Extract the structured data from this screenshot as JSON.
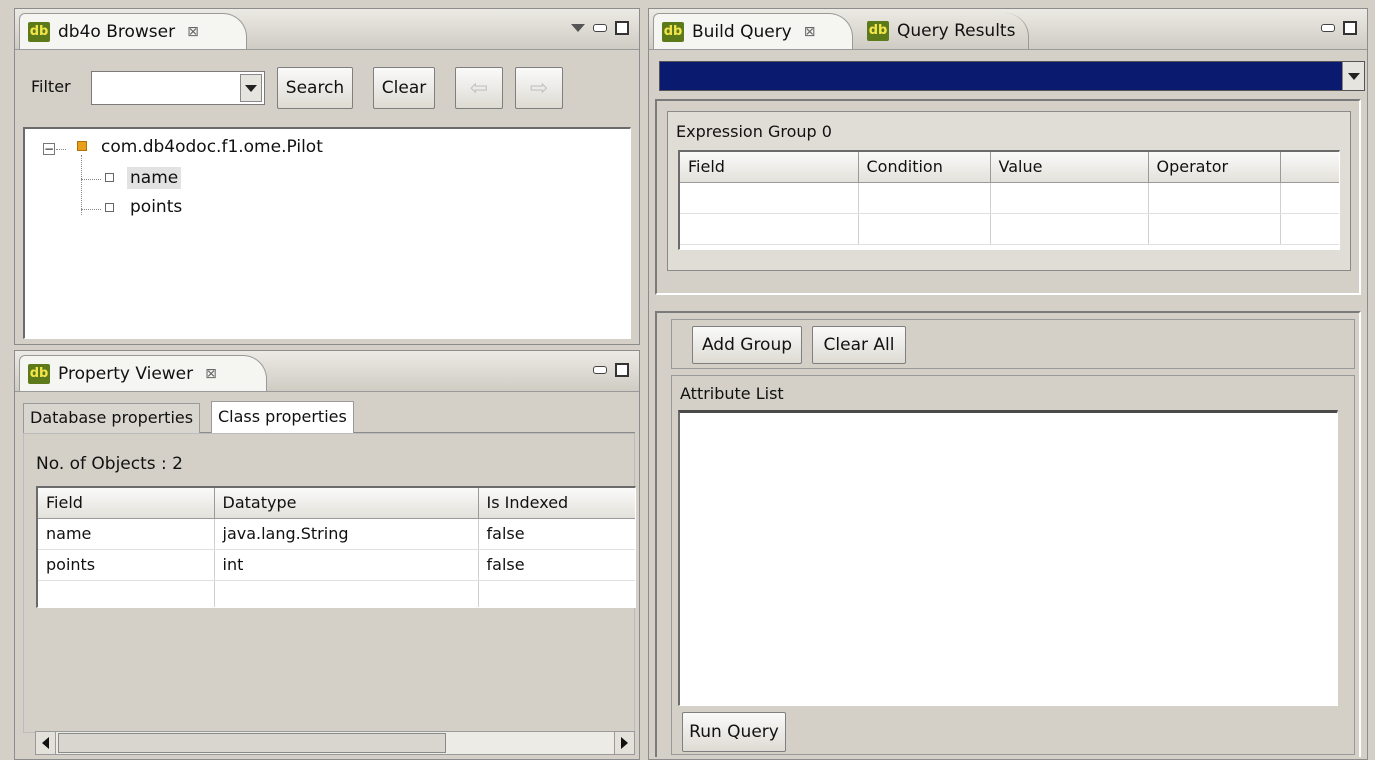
{
  "browser": {
    "tab_label": "db4o Browser",
    "filter_label": "Filter",
    "filter_value": "",
    "search_label": "Search",
    "clear_label": "Clear",
    "tree": {
      "root": "com.db4odoc.f1.ome.Pilot",
      "children": [
        "name",
        "points"
      ],
      "selected": "name"
    }
  },
  "property_viewer": {
    "tab_label": "Property Viewer",
    "tabs": [
      "Database properties",
      "Class properties"
    ],
    "active_tab": "Class properties",
    "objects_label": "No. of Objects : 2",
    "columns": [
      "Field",
      "Datatype",
      "Is Indexed"
    ],
    "rows": [
      [
        "name",
        "java.lang.String",
        "false"
      ],
      [
        "points",
        "int",
        "false"
      ]
    ]
  },
  "build_query": {
    "tab_label": "Build Query",
    "results_tab_label": "Query Results",
    "class_select_value": "",
    "group_title": "Expression Group 0",
    "columns": [
      "Field",
      "Condition",
      "Value",
      "Operator"
    ],
    "add_group_label": "Add Group",
    "clear_all_label": "Clear All",
    "attribute_list_label": "Attribute List",
    "run_query_label": "Run Query"
  },
  "icons": {
    "db": "db",
    "close": "⊠"
  },
  "colors": {
    "selection_bar": "#0a1a6e",
    "panel_bg": "#d4d0c8",
    "db_icon_bg": "#5d7a1a"
  }
}
